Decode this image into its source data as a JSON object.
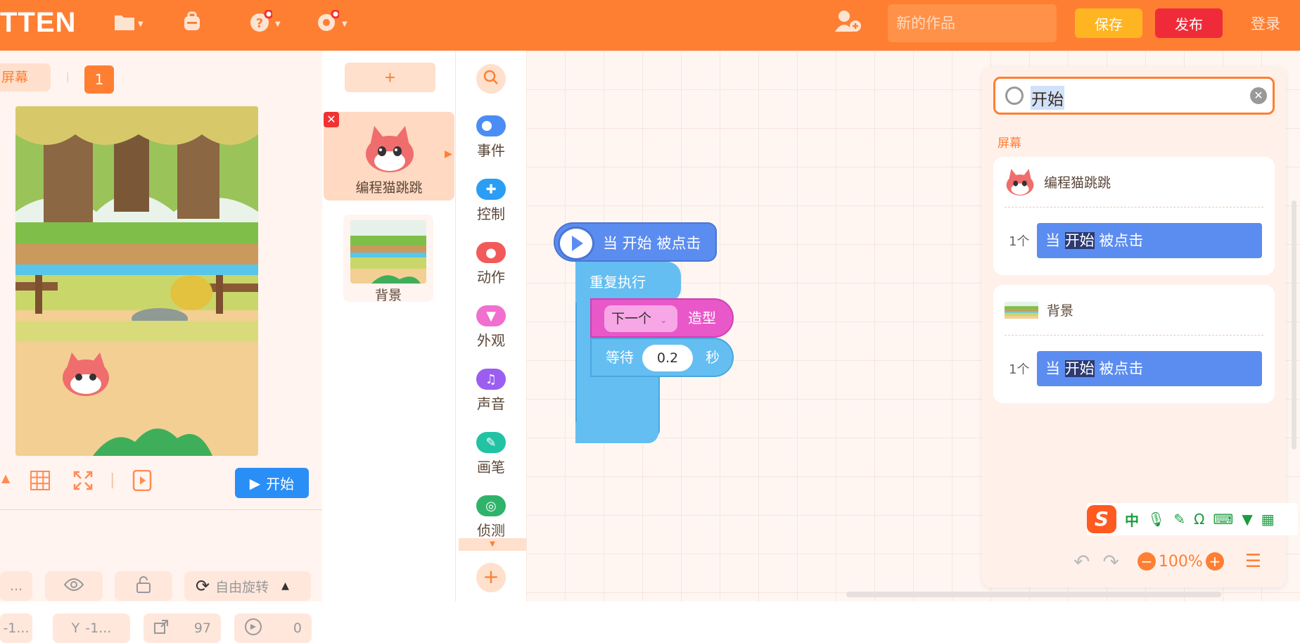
{
  "header": {
    "logo_text": "TTEN",
    "project_name_placeholder": "新的作品",
    "save_label": "保存",
    "publish_label": "发布",
    "login_label": "登录",
    "icons": [
      "folder-icon",
      "backpack-icon",
      "help-icon",
      "settings-icon",
      "add-user-icon"
    ]
  },
  "stage": {
    "screen_tab": "屏幕",
    "screen_count": "1",
    "start_button": "开始",
    "rotation_mode": "自由旋转",
    "name_field": "...",
    "x_field": "-1...",
    "y_label": "Y",
    "y_field": "-1...",
    "size_value": "97",
    "direction_value": "0"
  },
  "sprites": {
    "add_label": "+",
    "items": [
      {
        "name": "编程猫跳跳",
        "selected": true
      },
      {
        "name": "背景",
        "selected": false
      }
    ]
  },
  "categories": [
    {
      "label": "事件",
      "color": "#4c8df5"
    },
    {
      "label": "控制",
      "color": "#2a9df4"
    },
    {
      "label": "动作",
      "color": "#f25a5a"
    },
    {
      "label": "外观",
      "color": "#f06fcf"
    },
    {
      "label": "声音",
      "color": "#9b5ef0"
    },
    {
      "label": "画笔",
      "color": "#22c2a5"
    },
    {
      "label": "侦测",
      "color": "#2fb36b"
    }
  ],
  "workspace": {
    "hat_block": "当 开始 被点击",
    "repeat_block": "重复执行",
    "costume_dropdown": "下一个",
    "costume_label": "造型",
    "wait_label": "等待",
    "wait_value": "0.2",
    "wait_unit": "秒"
  },
  "search_panel": {
    "query": "开始",
    "section_label": "屏幕",
    "results": [
      {
        "target": "编程猫跳跳",
        "count": "1个",
        "block_prefix": "当",
        "block_match": "开始",
        "block_suffix": "被点击"
      },
      {
        "target": "背景",
        "count": "1个",
        "block_prefix": "当",
        "block_match": "开始",
        "block_suffix": "被点击"
      }
    ]
  },
  "ime": {
    "logo": "S",
    "mode": "中"
  },
  "zoom": {
    "level": "100%"
  }
}
